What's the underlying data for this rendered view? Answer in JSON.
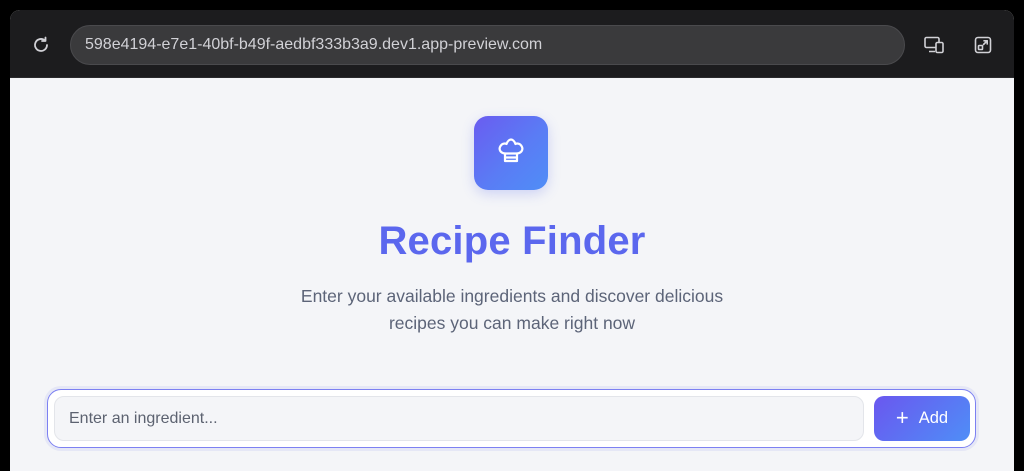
{
  "browser": {
    "url": "598e4194-e7e1-40bf-b49f-aedbf333b3a9.dev1.app-preview.com",
    "icons": {
      "reload": "reload-icon",
      "devices": "devices-icon",
      "expand": "expand-icon"
    }
  },
  "app": {
    "logo_icon": "chef-hat-icon",
    "title": "Recipe Finder",
    "subtitle_line1": "Enter your available ingredients and discover delicious",
    "subtitle_line2": "recipes you can make right now",
    "accent_color": "#5b67ee"
  },
  "ingredient_form": {
    "input_value": "",
    "input_placeholder": "Enter an ingredient...",
    "add_icon": "plus-icon",
    "add_label": "Add"
  }
}
